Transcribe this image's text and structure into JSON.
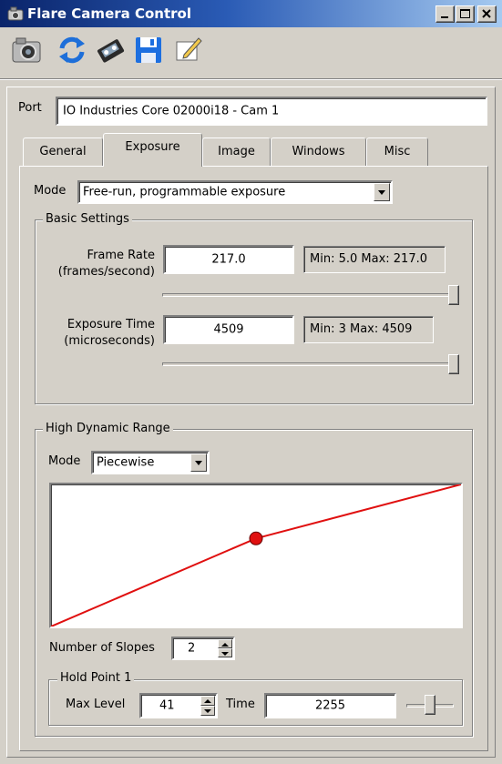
{
  "window": {
    "title": "Flare Camera Control"
  },
  "toolbar": {
    "icons": [
      "camera-icon",
      "refresh-icon",
      "tape-icon",
      "save-icon",
      "edit-icon"
    ]
  },
  "port": {
    "label": "Port",
    "value": "IO Industries Core 02000i18 - Cam 1"
  },
  "tabs": [
    {
      "label": "General"
    },
    {
      "label": "Exposure"
    },
    {
      "label": "Image"
    },
    {
      "label": "Windows"
    },
    {
      "label": "Misc"
    }
  ],
  "active_tab": "Exposure",
  "exposure": {
    "mode_label": "Mode",
    "mode_value": "Free-run, programmable exposure",
    "basic_settings": {
      "title": "Basic Settings",
      "frame_rate": {
        "label_line1": "Frame Rate",
        "label_line2": "(frames/second)",
        "value": "217.0",
        "range": "Min: 5.0  Max: 217.0",
        "slider_fraction": 1.0
      },
      "exposure_time": {
        "label_line1": "Exposure Time",
        "label_line2": "(microseconds)",
        "value": "4509",
        "range": "Min: 3  Max: 4509",
        "slider_fraction": 1.0
      }
    },
    "hdr": {
      "title": "High Dynamic Range",
      "mode_label": "Mode",
      "mode_value": "Piecewise",
      "curve_points": [
        [
          0,
          0
        ],
        [
          0.5,
          0.62
        ],
        [
          1,
          1
        ]
      ],
      "curve_color": "#e01010",
      "slopes_label": "Number of Slopes",
      "slopes_value": "2",
      "hold_point": {
        "title": "Hold Point 1",
        "max_level_label": "Max Level",
        "max_level_value": "41",
        "time_label": "Time",
        "time_value": "2255",
        "slider_fraction": 0.5
      }
    }
  }
}
